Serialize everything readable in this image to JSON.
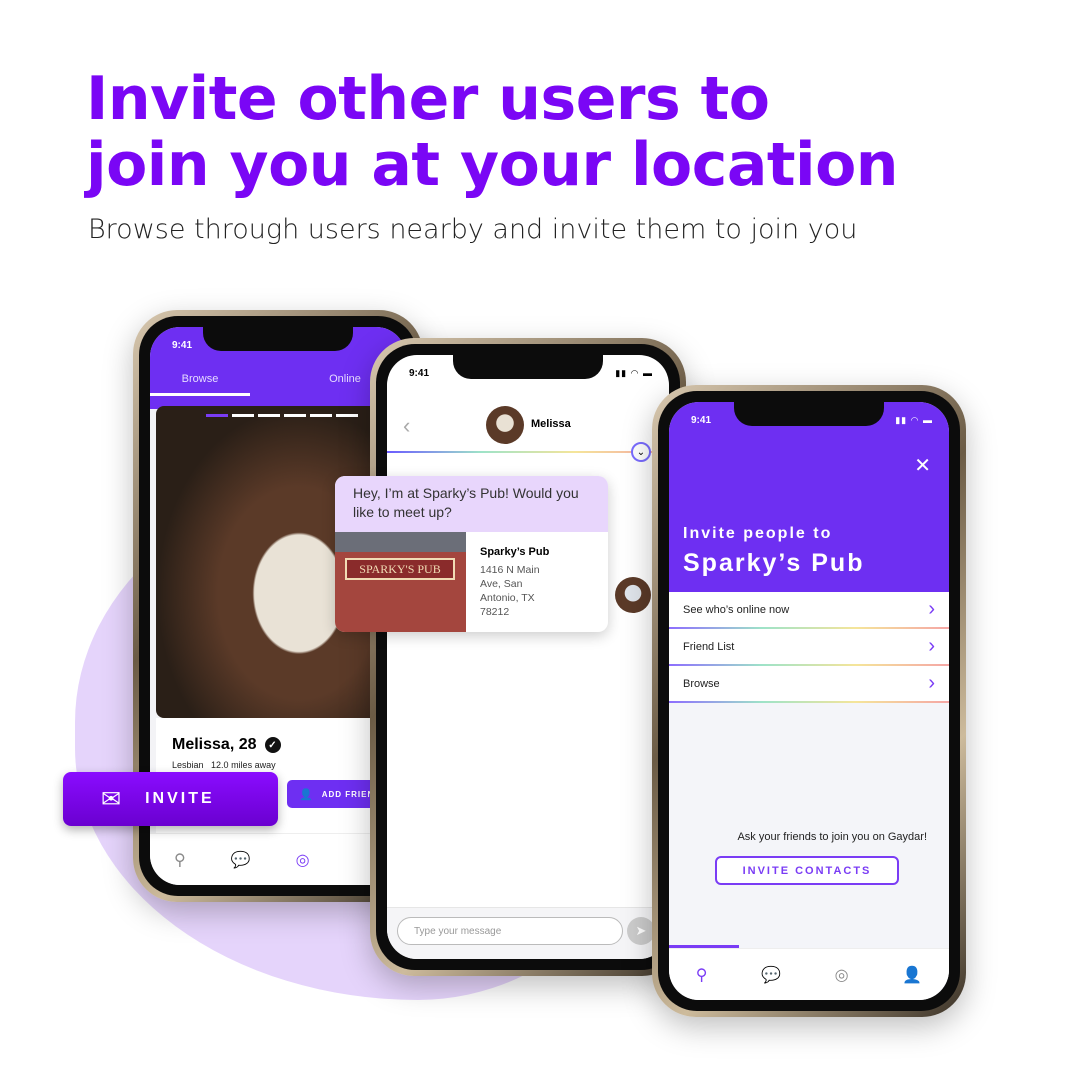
{
  "headline": {
    "line1": "Invite other users to",
    "line2": "join you at your location"
  },
  "subtitle": "Browse through users nearby and invite them to join you",
  "colors": {
    "brand": "#7a06f5",
    "header_purple": "#6e2ff2",
    "blob": "#e5d4fb",
    "bubble": "#e8d6fc"
  },
  "status_time": "9:41",
  "browse_screen": {
    "tabs": [
      {
        "label": "Browse",
        "active": true
      },
      {
        "label": "Online",
        "active": false
      }
    ],
    "photo_pages": 6,
    "active_photo": 1,
    "name": "Melissa, 28",
    "orientation": "Lesbian",
    "distance": "12.0 miles away",
    "add_friend_label": "ADD FRIEND",
    "nav_icons": [
      "location-pin-icon",
      "chat-icon",
      "radar-icon",
      "profile-icon"
    ]
  },
  "invite_button": {
    "label": "INVITE",
    "icon": "envelope-pin-icon"
  },
  "chat_screen": {
    "contact_name": "Melissa",
    "message": "Hey, I’m at Sparky’s Pub! Would you like to meet up?",
    "place_name": "Sparky’s Pub",
    "place_address": "1416 N Main Ave, San Antonio, TX 78212",
    "place_sign": "SPARKY'S PUB",
    "input_placeholder": "Type your message"
  },
  "invite_screen": {
    "heading_small": "Invite people to",
    "heading_large": "Sparky’s Pub",
    "options": [
      {
        "label": "See who’s online now"
      },
      {
        "label": "Friend List"
      },
      {
        "label": "Browse"
      }
    ],
    "prompt": "Ask your friends to join you on Gaydar!",
    "invite_contacts_label": "INVITE CONTACTS",
    "nav_icons": [
      "location-pin-icon",
      "chat-icon",
      "radar-icon",
      "profile-icon"
    ],
    "active_nav": 0
  }
}
